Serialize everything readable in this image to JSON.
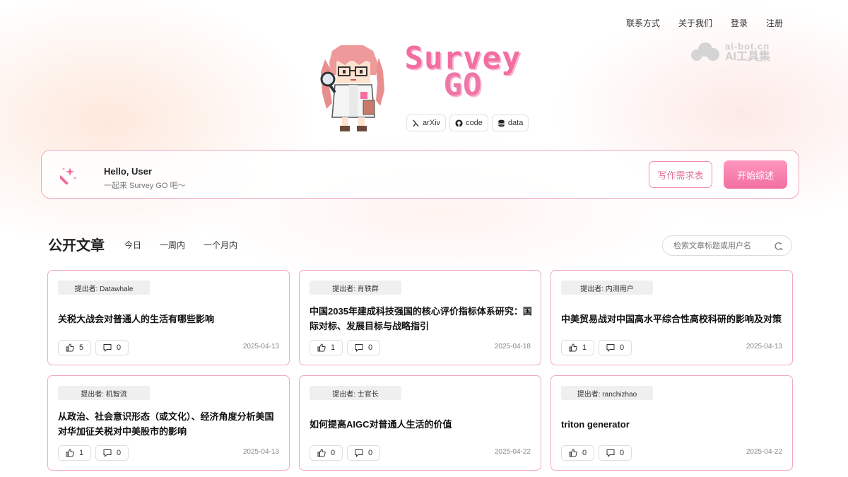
{
  "nav": {
    "contact": "联系方式",
    "about": "关于我们",
    "login": "登录",
    "register": "注册"
  },
  "watermark": {
    "line1": "ai-bot.cn",
    "line2": "AI工具集"
  },
  "brand": {
    "line1": "Survey",
    "line2": "GO",
    "links": [
      {
        "label": "arXiv",
        "icon": "arxiv-icon"
      },
      {
        "label": "code",
        "icon": "github-icon"
      },
      {
        "label": "data",
        "icon": "database-icon"
      }
    ]
  },
  "hello": {
    "title": "Hello, User",
    "subtitle": "一起来 Survey GO 吧～",
    "form_button": "写作需求表",
    "start_button": "开始综述",
    "icon": "magic-wand-icon"
  },
  "articles": {
    "section_title": "公开文章",
    "filters": [
      "今日",
      "一周内",
      "一个月内"
    ],
    "search_placeholder": "检索文章标题或用户名",
    "items": [
      {
        "author": "提出者: Datawhale",
        "title": "关税大战会对普通人的生活有哪些影响",
        "likes": "5",
        "comments": "0",
        "date": "2025-04-13"
      },
      {
        "author": "提出者: 肖轶群",
        "title": "中国2035年建成科技强国的核心评价指标体系研究：国际对标、发展目标与战略指引",
        "likes": "1",
        "comments": "0",
        "date": "2025-04-18"
      },
      {
        "author": "提出者: 内测用户",
        "title": "中美贸易战对中国高水平综合性高校科研的影响及对策",
        "likes": "1",
        "comments": "0",
        "date": "2025-04-13"
      },
      {
        "author": "提出者: 机智流",
        "title": "从政治、社会意识形态（或文化）、经济角度分析美国对华加征关税对中美股市的影响",
        "likes": "1",
        "comments": "0",
        "date": "2025-04-13"
      },
      {
        "author": "提出者: 士官长",
        "title": "如何提高AIGC对普通人生活的价值",
        "likes": "0",
        "comments": "0",
        "date": "2025-04-22"
      },
      {
        "author": "提出者: ranchizhao",
        "title": "triton generator",
        "likes": "0",
        "comments": "0",
        "date": "2025-04-22"
      }
    ]
  },
  "colors": {
    "accent": "#f26ea1",
    "border_pink": "#f2a9c2"
  }
}
